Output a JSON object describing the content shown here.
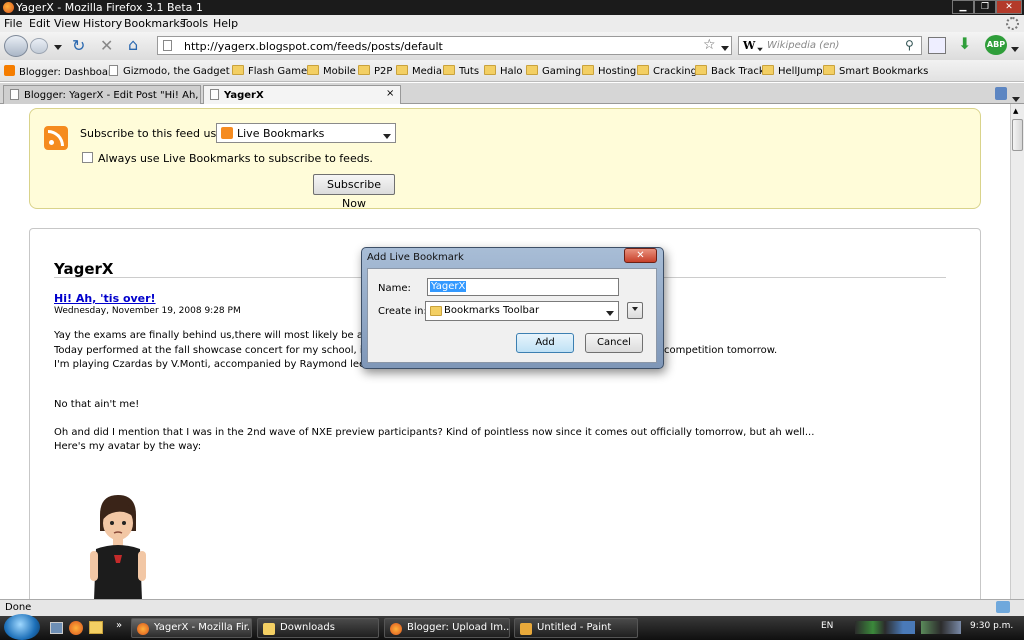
{
  "window": {
    "title": "YagerX - Mozilla Firefox 3.1 Beta 1"
  },
  "menubar": {
    "items": [
      "File",
      "Edit",
      "View",
      "History",
      "Bookmarks",
      "Tools",
      "Help"
    ]
  },
  "navbar": {
    "url": "http://yagerx.blogspot.com/feeds/posts/default",
    "search_engine_letter": "W",
    "search_placeholder": "Wikipedia (en)",
    "abp_label": "ABP"
  },
  "bookmarks": {
    "items": [
      "Blogger: Dashboard",
      "Gizmodo, the Gadget ...",
      "Flash Games",
      "Mobile",
      "P2P",
      "Media",
      "Tuts",
      "Halo",
      "Gaming",
      "Hosting",
      "Cracking",
      "Back Track",
      "HellJump",
      "Smart Bookmarks"
    ]
  },
  "tabs": [
    {
      "label": "Blogger: YagerX - Edit Post \"Hi! Ah, ...",
      "close": "×"
    },
    {
      "label": "YagerX",
      "close": "×"
    }
  ],
  "feed": {
    "subscribe_label": "Subscribe to this feed using",
    "subscribe_option": "Live Bookmarks",
    "always_use": "Always use Live Bookmarks to subscribe to feeds.",
    "subscribe_button": "Subscribe Now",
    "title": "YagerX",
    "post_title": "Hi! Ah, 'tis over!",
    "post_date": "Wednesday, November 19, 2008 9:28 PM",
    "paragraphs": [
      "Yay the exams are finally behind us,there will most likely be a torre",
      "Today performed at the fall showcase concert for my school, it wa",
      "competition tomorrow.",
      "I'm playing Czardas by V.Monti, accompanied by Raymond lee:",
      "No that ain't me!",
      "Oh and did I mention that I was in the 2nd wave of NXE preview participants? Kind of pointless now since it comes out officially tomorrow, but ah well...",
      "Here's my avatar by the way:"
    ]
  },
  "dialog": {
    "title": "Add Live Bookmark",
    "close": "✕",
    "name_label": "Name:",
    "name_value": "YagerX",
    "create_label": "Create in:",
    "create_value": "Bookmarks Toolbar",
    "add_button": "Add",
    "cancel_button": "Cancel"
  },
  "status": {
    "text": "Done"
  },
  "taskbar": {
    "buttons": [
      "YagerX - Mozilla Fir...",
      "Downloads",
      "Blogger: Upload Im...",
      "Untitled - Paint"
    ],
    "language": "EN",
    "clock": "9:30 p.m."
  },
  "colors": {
    "feed_bg": "#fffcd9",
    "link": "#0000cc",
    "rss": "#f58b1f",
    "selection": "#3399ff"
  }
}
